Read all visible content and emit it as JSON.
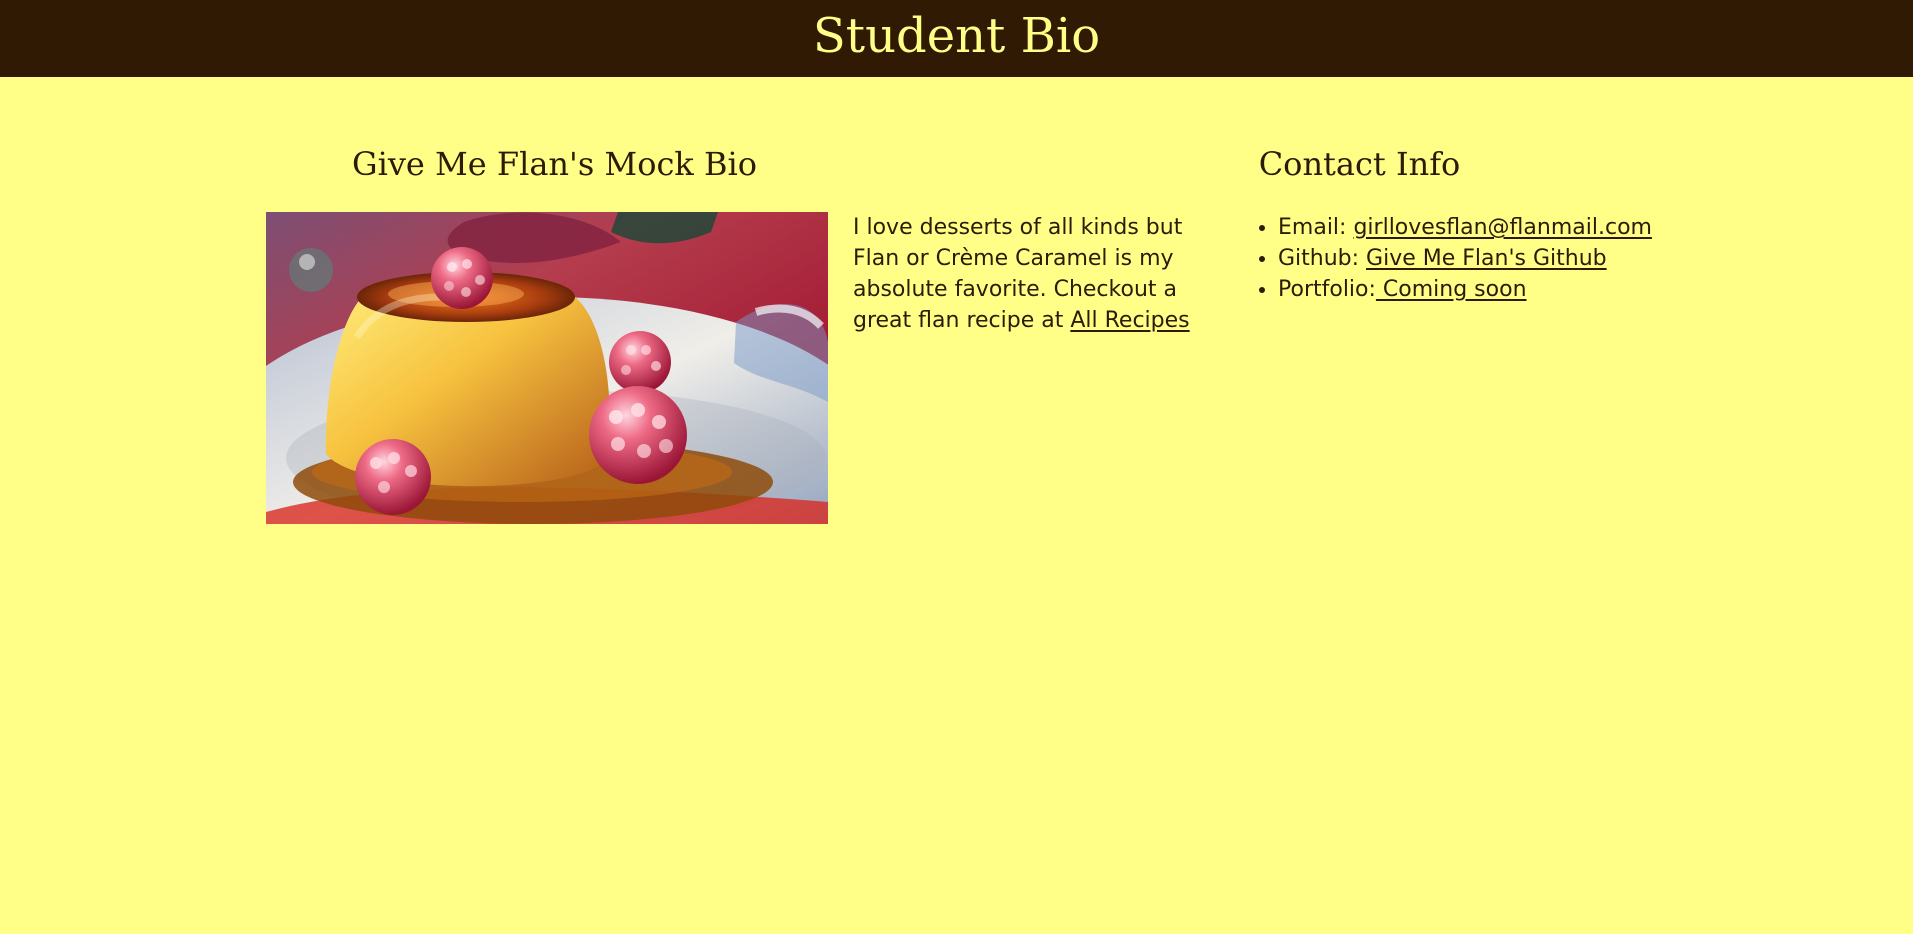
{
  "header": {
    "title": "Student Bio"
  },
  "bio": {
    "heading": "Give Me Flan's Mock Bio",
    "image_alt": "Flan with raspberries",
    "text_before_link": "I love desserts of all kinds but Flan or Crème Caramel is my absolute favorite. Checkout a great flan recipe at ",
    "recipe_link_text": "All Recipes"
  },
  "contact": {
    "heading": "Contact Info",
    "email_label": "Email: ",
    "email_link_text": "girllovesflan@flanmail.com",
    "github_label": "Github: ",
    "github_link_text": "Give Me Flan's Github",
    "portfolio_label": "Portfolio:",
    "portfolio_link_text": " Coming soon"
  },
  "colors": {
    "page_background": "#ffff88",
    "header_background": "#301a03",
    "header_text": "#ffff88",
    "body_text": "#2f1a08"
  }
}
